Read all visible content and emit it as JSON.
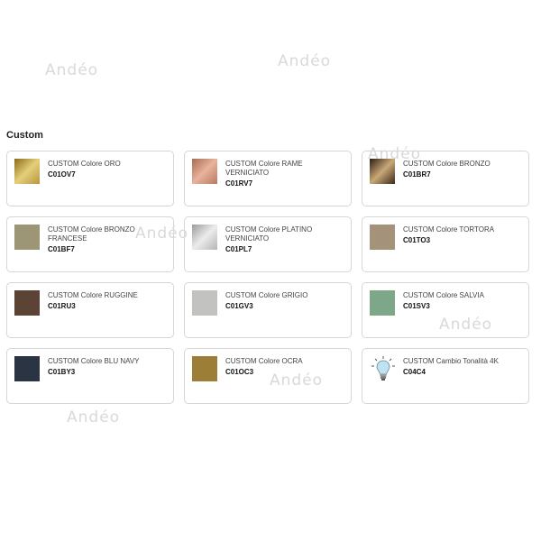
{
  "watermark": "Andéo",
  "section": {
    "title": "Custom"
  },
  "items": [
    {
      "name": "CUSTOM Colore ORO",
      "code": "C01OV7",
      "swatch": "gold",
      "colors": [
        "#8a6a1c",
        "#e6cf7a",
        "#b89540"
      ]
    },
    {
      "name": "CUSTOM Colore RAME VERNICIATO",
      "code": "C01RV7",
      "swatch": "copper",
      "colors": [
        "#a76b52",
        "#e8b29c",
        "#b97a60"
      ]
    },
    {
      "name": "CUSTOM Colore BRONZO",
      "code": "C01BR7",
      "swatch": "bronze",
      "colors": [
        "#2a1d12",
        "#c9a877",
        "#3a2a1a"
      ]
    },
    {
      "name": "CUSTOM Colore BRONZO FRANCESE",
      "code": "C01BF7",
      "swatch": "bronze-francese",
      "colors": [
        "#9d9676"
      ]
    },
    {
      "name": "CUSTOM Colore PLATINO VERNICIATO",
      "code": "C01PL7",
      "swatch": "platino",
      "colors": [
        "#9a9a9a",
        "#ececec",
        "#b5b5b5"
      ]
    },
    {
      "name": "CUSTOM Colore TORTORA",
      "code": "C01TO3",
      "swatch": "tortora",
      "colors": [
        "#a5927b"
      ]
    },
    {
      "name": "CUSTOM Colore RUGGINE",
      "code": "C01RU3",
      "swatch": "ruggine",
      "colors": [
        "#5b4436"
      ]
    },
    {
      "name": "CUSTOM Colore GRIGIO",
      "code": "C01GV3",
      "swatch": "grigio",
      "colors": [
        "#c2c2c0"
      ]
    },
    {
      "name": "CUSTOM Colore SALVIA",
      "code": "C01SV3",
      "swatch": "salvia",
      "colors": [
        "#7ea689"
      ]
    },
    {
      "name": "CUSTOM Colore BLU NAVY",
      "code": "C01BY3",
      "swatch": "blu-navy",
      "colors": [
        "#2b3443"
      ]
    },
    {
      "name": "CUSTOM Colore OCRA",
      "code": "C01OC3",
      "swatch": "ocra",
      "colors": [
        "#9c7e37"
      ]
    },
    {
      "name": "CUSTOM Cambio Tonalità 4K",
      "code": "C04C4",
      "swatch": "lightbulb-icon",
      "colors": [
        "#bfe3f2"
      ]
    }
  ]
}
